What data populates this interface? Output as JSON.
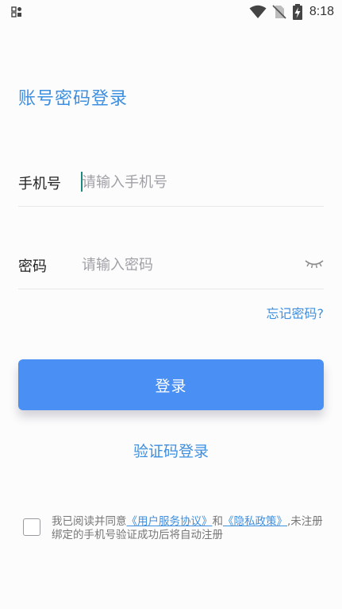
{
  "status_bar": {
    "time": "8:18",
    "icons": [
      "notification-grid-icon",
      "wifi-icon",
      "no-sim-icon",
      "battery-charging-icon"
    ]
  },
  "title": "账号密码登录",
  "phone": {
    "label": "手机号",
    "placeholder": "请输入手机号"
  },
  "password": {
    "label": "密码",
    "placeholder": "请输入密码",
    "toggle_icon": "eye-closed-icon"
  },
  "forgot_password": "忘记密码?",
  "login_button": "登录",
  "code_login": "验证码登录",
  "agreement": {
    "prefix": "我已阅读并同意",
    "user_agreement": "《用户服务协议》",
    "and": "和",
    "privacy_policy": "《隐私政策》",
    "suffix": ",未注册绑定的手机号验证成功后将自动注册",
    "checked": false
  },
  "colors": {
    "accent": "#3d8fe0",
    "button": "#4a8ff4",
    "caret": "#1a8a7a"
  }
}
